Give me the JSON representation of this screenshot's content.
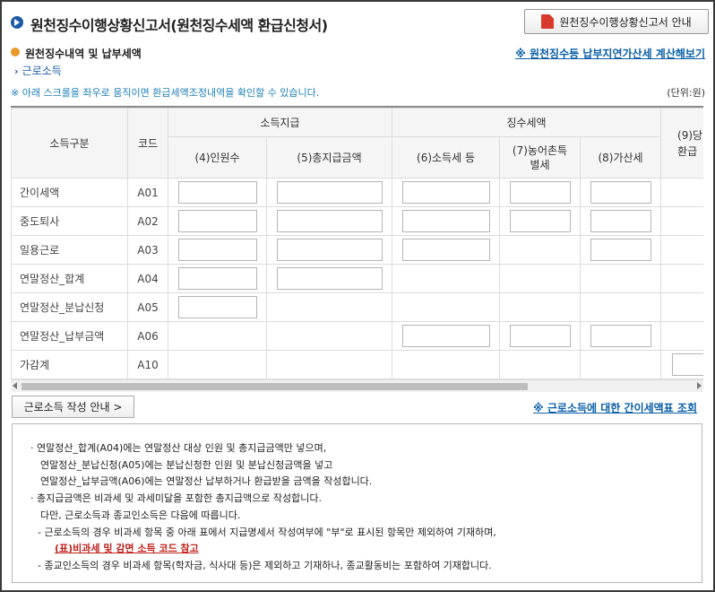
{
  "header": {
    "title": "원천징수이행상황신고서(원천징수세액 환급신청서)",
    "guide_button": "원천징수이행상황신고서 안내"
  },
  "section": {
    "title": "원천징수내역 및 납부세액",
    "calc_link": "※ 원천징수등 납부지연가산세 계산해보기",
    "subsection": "근로소득",
    "scroll_note": "※ 아래 스크롤을 좌우로 움직이면 환급세액조정내역을 확인할 수 있습니다.",
    "unit": "(단위:원)"
  },
  "table": {
    "headers": {
      "income_type": "소득구분",
      "code": "코드",
      "group_payment": "소득지급",
      "group_tax": "징수세액",
      "col4": "(4)인원수",
      "col5": "(5)총지급금액",
      "col6": "(6)소득세 등",
      "col7": "(7)농어촌특별세",
      "col8": "(8)가산세",
      "col9_line1": "(9)당",
      "col9_line2": "환급"
    },
    "rows": [
      {
        "label": "간이세액",
        "code": "A01"
      },
      {
        "label": "중도퇴사",
        "code": "A02"
      },
      {
        "label": "일용근로",
        "code": "A03"
      },
      {
        "label": "연말정산_합계",
        "code": "A04"
      },
      {
        "label": "연말정산_분납신청",
        "code": "A05"
      },
      {
        "label": "연말정산_납부금액",
        "code": "A06"
      },
      {
        "label": "가감계",
        "code": "A10"
      }
    ]
  },
  "actions": {
    "earned_income_guide": "근로소득 작성 안내 >",
    "simple_tax_table_link": "※ 근로소득에 대한 간이세액표 조회"
  },
  "notes": {
    "line1": "· 연말정산_합계(A04)에는 연말정산 대상 인원 및 총지급금액만 넣으며,",
    "line2": "연말정산_분납신청(A05)에는 분납신청한 인원 및 분납신청금액을 넣고",
    "line3": "연말정산_납부금액(A06)에는 연말정산 납부하거나 환급받을 금액을 작성합니다.",
    "line4": "· 총지급금액은 비과세 및 과세미달을 포함한 총지급액으로 작성합니다.",
    "line5": "다만, 근로소득과 종교인소득은 다음에 따릅니다.",
    "line6": "- 근로소득의 경우 비과세 항목 중 아래 표에서 지급명세서 작성여부에 \"부\"로 표시된 항목만 제외하여 기재하며,",
    "link": "(표)비과세 및 감면 소득 코드 참고",
    "line7": "- 종교인소득의 경우 비과세 항목(학자금, 식사대 등)은 제외하고 기재하나, 종교활동비는 포함하여 기재합니다."
  }
}
